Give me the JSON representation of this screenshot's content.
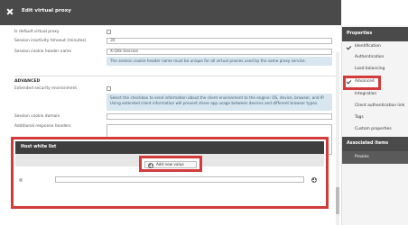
{
  "window": {
    "title": "Edit virtual proxy"
  },
  "form": {
    "default_proxy_label": "Is default virtual proxy",
    "inactivity_label": "Session inactivity timeout (minutes)",
    "inactivity_value": "30",
    "cookie_label": "Session cookie header name",
    "cookie_value": "X-Qlik-Session",
    "cookie_info": "The session cookie header name must be unique for all virtual proxies used by the same proxy service.",
    "advanced_title": "ADVANCED",
    "ext_security_label": "Extended security environment",
    "ext_security_info": "Select the checkbox to send information about the client environment to the engine: OS, device, browser, and IP. Using extended client information will prevent share app usage between devices and different browser types.",
    "cookie_domain_label": "Session cookie domain",
    "additional_headers_label": "Additional response headers"
  },
  "host_white_list": {
    "title": "Host white list",
    "add_label": "Add new value"
  },
  "sidebar": {
    "properties_title": "Properties",
    "items": [
      {
        "label": "Identification",
        "checked": true
      },
      {
        "label": "Authentication",
        "checked": false
      },
      {
        "label": "Load balancing",
        "checked": false
      },
      {
        "label": "Advanced",
        "checked": true
      },
      {
        "label": "Integration",
        "checked": false
      },
      {
        "label": "Client authentication link",
        "checked": false
      },
      {
        "label": "Tags",
        "checked": false
      },
      {
        "label": "Custom properties",
        "checked": false
      }
    ],
    "associated_title": "Associated items",
    "associated_items": [
      {
        "label": "Proxies"
      }
    ]
  },
  "colors": {
    "highlight": "#d33a3a",
    "header": "#4a4a4a",
    "info_bg": "#d8e6f0"
  },
  "icons": {
    "close": "close-icon",
    "add": "plus-circle-icon",
    "check": "check-icon"
  }
}
